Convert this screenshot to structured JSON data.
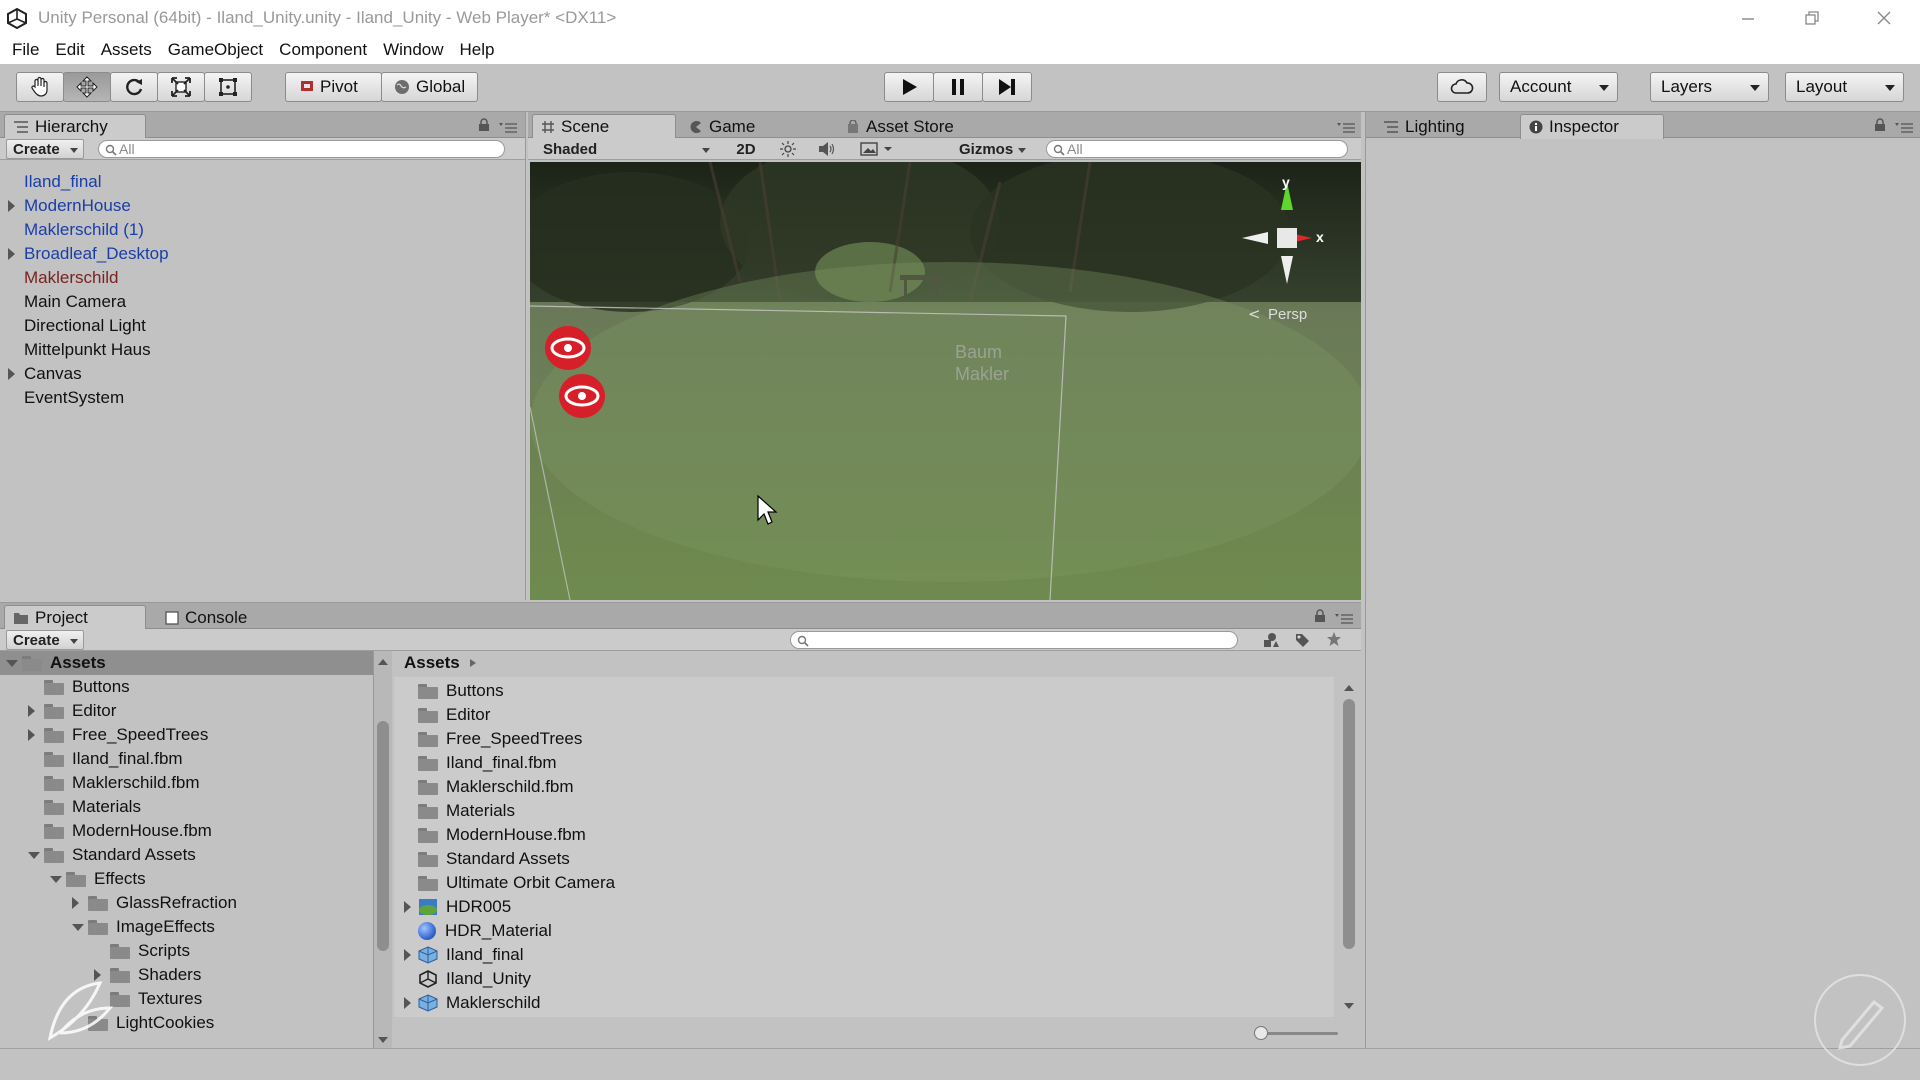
{
  "window": {
    "title": "Unity Personal (64bit) - Iland_Unity.unity - Iland_Unity - Web Player* <DX11>"
  },
  "menu": [
    "File",
    "Edit",
    "Assets",
    "GameObject",
    "Component",
    "Window",
    "Help"
  ],
  "toolbar": {
    "pivot_label": "Pivot",
    "global_label": "Global",
    "account_label": "Account",
    "layers_label": "Layers",
    "layout_label": "Layout",
    "tools": [
      "hand-tool-icon",
      "move-tool-icon",
      "rotate-tool-icon",
      "scale-tool-icon",
      "rect-tool-icon"
    ],
    "playback": [
      "play-icon",
      "pause-icon",
      "step-icon"
    ]
  },
  "hierarchy": {
    "tab_label": "Hierarchy",
    "create_label": "Create",
    "search_placeholder": "All",
    "items": [
      {
        "label": "Iland_final",
        "color": "blue",
        "expandable": false
      },
      {
        "label": "ModernHouse",
        "color": "blue",
        "expandable": true
      },
      {
        "label": "Maklerschild (1)",
        "color": "blue",
        "expandable": false
      },
      {
        "label": "Broadleaf_Desktop",
        "color": "blue",
        "expandable": true
      },
      {
        "label": "Maklerschild",
        "color": "red",
        "expandable": false
      },
      {
        "label": "Main Camera",
        "color": "black",
        "expandable": false
      },
      {
        "label": "Directional Light",
        "color": "black",
        "expandable": false
      },
      {
        "label": "Mittelpunkt Haus",
        "color": "black",
        "expandable": false
      },
      {
        "label": "Canvas",
        "color": "black",
        "expandable": true
      },
      {
        "label": "EventSystem",
        "color": "black",
        "expandable": false
      }
    ]
  },
  "scene": {
    "tabs": [
      "Scene",
      "Game",
      "Asset Store"
    ],
    "shading_label": "Shaded",
    "mode_2d_label": "2D",
    "gizmos_label": "Gizmos",
    "search_placeholder": "All",
    "persp_label": "Persp",
    "axis_y": "y",
    "axis_x": "x",
    "world_label_line1": "Baum",
    "world_label_line2": "Makler"
  },
  "right_panel": {
    "tabs": [
      "Lighting",
      "Inspector"
    ]
  },
  "project": {
    "tabs": [
      "Project",
      "Console"
    ],
    "create_label": "Create",
    "tree": [
      {
        "label": "Assets",
        "depth": 0,
        "fold": "open",
        "selected": true
      },
      {
        "label": "Buttons",
        "depth": 1,
        "fold": "none"
      },
      {
        "label": "Editor",
        "depth": 1,
        "fold": "closed"
      },
      {
        "label": "Free_SpeedTrees",
        "depth": 1,
        "fold": "closed"
      },
      {
        "label": "Iland_final.fbm",
        "depth": 1,
        "fold": "none"
      },
      {
        "label": "Maklerschild.fbm",
        "depth": 1,
        "fold": "none"
      },
      {
        "label": "Materials",
        "depth": 1,
        "fold": "none"
      },
      {
        "label": "ModernHouse.fbm",
        "depth": 1,
        "fold": "none"
      },
      {
        "label": "Standard Assets",
        "depth": 1,
        "fold": "open"
      },
      {
        "label": "Effects",
        "depth": 2,
        "fold": "open"
      },
      {
        "label": "GlassRefraction",
        "depth": 3,
        "fold": "closed"
      },
      {
        "label": "ImageEffects",
        "depth": 3,
        "fold": "open"
      },
      {
        "label": "Scripts",
        "depth": 4,
        "fold": "none"
      },
      {
        "label": "Shaders",
        "depth": 4,
        "fold": "closed"
      },
      {
        "label": "Textures",
        "depth": 4,
        "fold": "none"
      },
      {
        "label": "LightCookies",
        "depth": 3,
        "fold": "none"
      }
    ],
    "breadcrumb": "Assets",
    "assets": [
      {
        "label": "Buttons",
        "icon": "folder",
        "fold": false
      },
      {
        "label": "Editor",
        "icon": "folder",
        "fold": false
      },
      {
        "label": "Free_SpeedTrees",
        "icon": "folder",
        "fold": false
      },
      {
        "label": "Iland_final.fbm",
        "icon": "folder",
        "fold": false
      },
      {
        "label": "Maklerschild.fbm",
        "icon": "folder",
        "fold": false
      },
      {
        "label": "Materials",
        "icon": "folder",
        "fold": false
      },
      {
        "label": "ModernHouse.fbm",
        "icon": "folder",
        "fold": false
      },
      {
        "label": "Standard Assets",
        "icon": "folder",
        "fold": false
      },
      {
        "label": "Ultimate Orbit Camera",
        "icon": "folder",
        "fold": false
      },
      {
        "label": "HDR005",
        "icon": "texture",
        "fold": true
      },
      {
        "label": "HDR_Material",
        "icon": "material",
        "fold": false
      },
      {
        "label": "Iland_final",
        "icon": "model",
        "fold": true
      },
      {
        "label": "Iland_Unity",
        "icon": "unity",
        "fold": false
      },
      {
        "label": "Maklerschild",
        "icon": "model",
        "fold": true
      }
    ]
  },
  "colors": {
    "hierarchy_blue": "#1a3ea8",
    "hierarchy_red": "#7a2222",
    "panel_bg": "#c2c2c2",
    "selection": "#8f8f8f"
  }
}
